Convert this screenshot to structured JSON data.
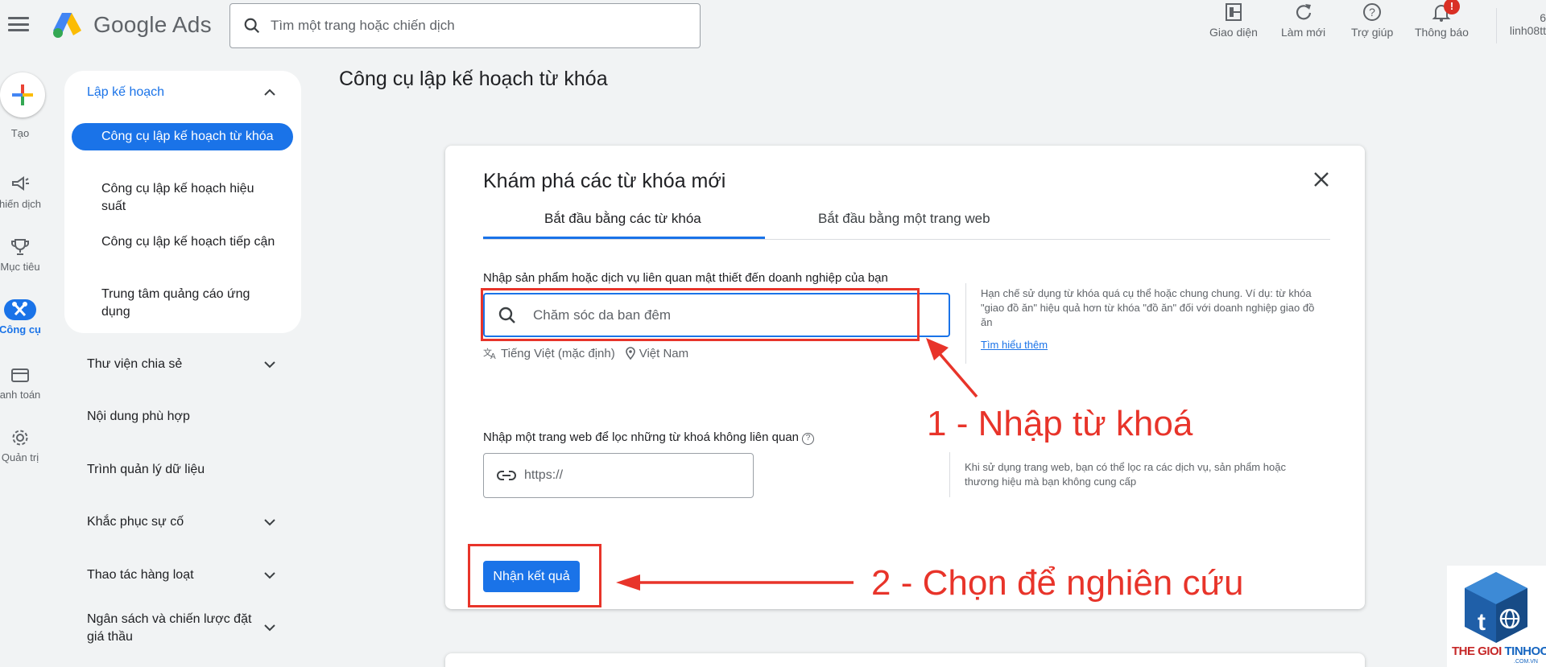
{
  "header": {
    "brand": "Google Ads",
    "search_placeholder": "Tìm một trang hoặc chiến dịch",
    "tools": [
      {
        "label": "Giao diện",
        "icon": "appearance-icon"
      },
      {
        "label": "Làm mới",
        "icon": "refresh-icon"
      },
      {
        "label": "Trợ giúp",
        "icon": "help-icon"
      },
      {
        "label": "Thông báo",
        "icon": "bell-icon"
      }
    ],
    "notification_badge": "!",
    "account_line1": "6",
    "account_line2": "linh08tt"
  },
  "rail": {
    "create": "Tạo",
    "items": [
      {
        "label": "hiến dịch",
        "icon": "megaphone-icon"
      },
      {
        "label": "Mục tiêu",
        "icon": "trophy-icon"
      },
      {
        "label": "Công cụ",
        "icon": "tools-icon",
        "active": true
      },
      {
        "label": "anh toán",
        "icon": "credit-card-icon"
      },
      {
        "label": "Quản trị",
        "icon": "gear-icon"
      }
    ]
  },
  "nav": {
    "section": "Lập kế hoạch",
    "sub_items": [
      "Công cụ lập kế hoạch từ khóa",
      "Công cụ lập kế hoạch hiệu suất",
      "Công cụ lập kế hoạch tiếp cận",
      "Trung tâm quảng cáo ứng dụng"
    ],
    "items": [
      "Thư viện chia sẻ",
      "Nội dung phù hợp",
      "Trình quản lý dữ liệu",
      "Khắc phục sự cố",
      "Thao tác hàng loạt",
      "Ngân sách và chiến lược đặt giá thầu"
    ]
  },
  "page": {
    "title": "Công cụ lập kế hoạch từ khóa"
  },
  "dialog": {
    "title": "Khám phá các từ khóa mới",
    "tabs": [
      "Bắt đầu bằng các từ khóa",
      "Bắt đầu bằng một trang web"
    ],
    "keyword_label": "Nhập sản phẩm hoặc dịch vụ liên quan mật thiết đến doanh nghiệp của bạn",
    "keyword_placeholder": "Chăm sóc da ban đêm",
    "language": "Tiếng Việt (mặc định)",
    "location": "Việt Nam",
    "hint": "Hạn chế sử dụng từ khóa quá cụ thể hoặc chung chung. Ví dụ: từ khóa \"giao đồ ăn\" hiệu quả hơn từ khóa \"đồ ăn\" đối với doanh nghiệp giao đồ ăn",
    "hint_link": "Tìm hiểu thêm",
    "url_label": "Nhập một trang web để lọc những từ khoá không liên quan",
    "url_placeholder": "https://",
    "url_hint": "Khi sử dụng trang web, bạn có thể lọc ra các dịch vụ, sản phẩm hoặc thương hiệu mà bạn không cung cấp",
    "submit": "Nhận kết quả"
  },
  "annotations": {
    "step1": "1 - Nhập từ khoá",
    "step2": "2 - Chọn để nghiên cứu",
    "color": "#e8342a"
  },
  "watermark": {
    "text_red": "THE GIOI",
    "text_blue": "TINHOC",
    "sub": ".COM.VN"
  },
  "colors": {
    "primary": "#1a73e8",
    "background": "#f1f3f4",
    "annotation": "#e8342a"
  }
}
